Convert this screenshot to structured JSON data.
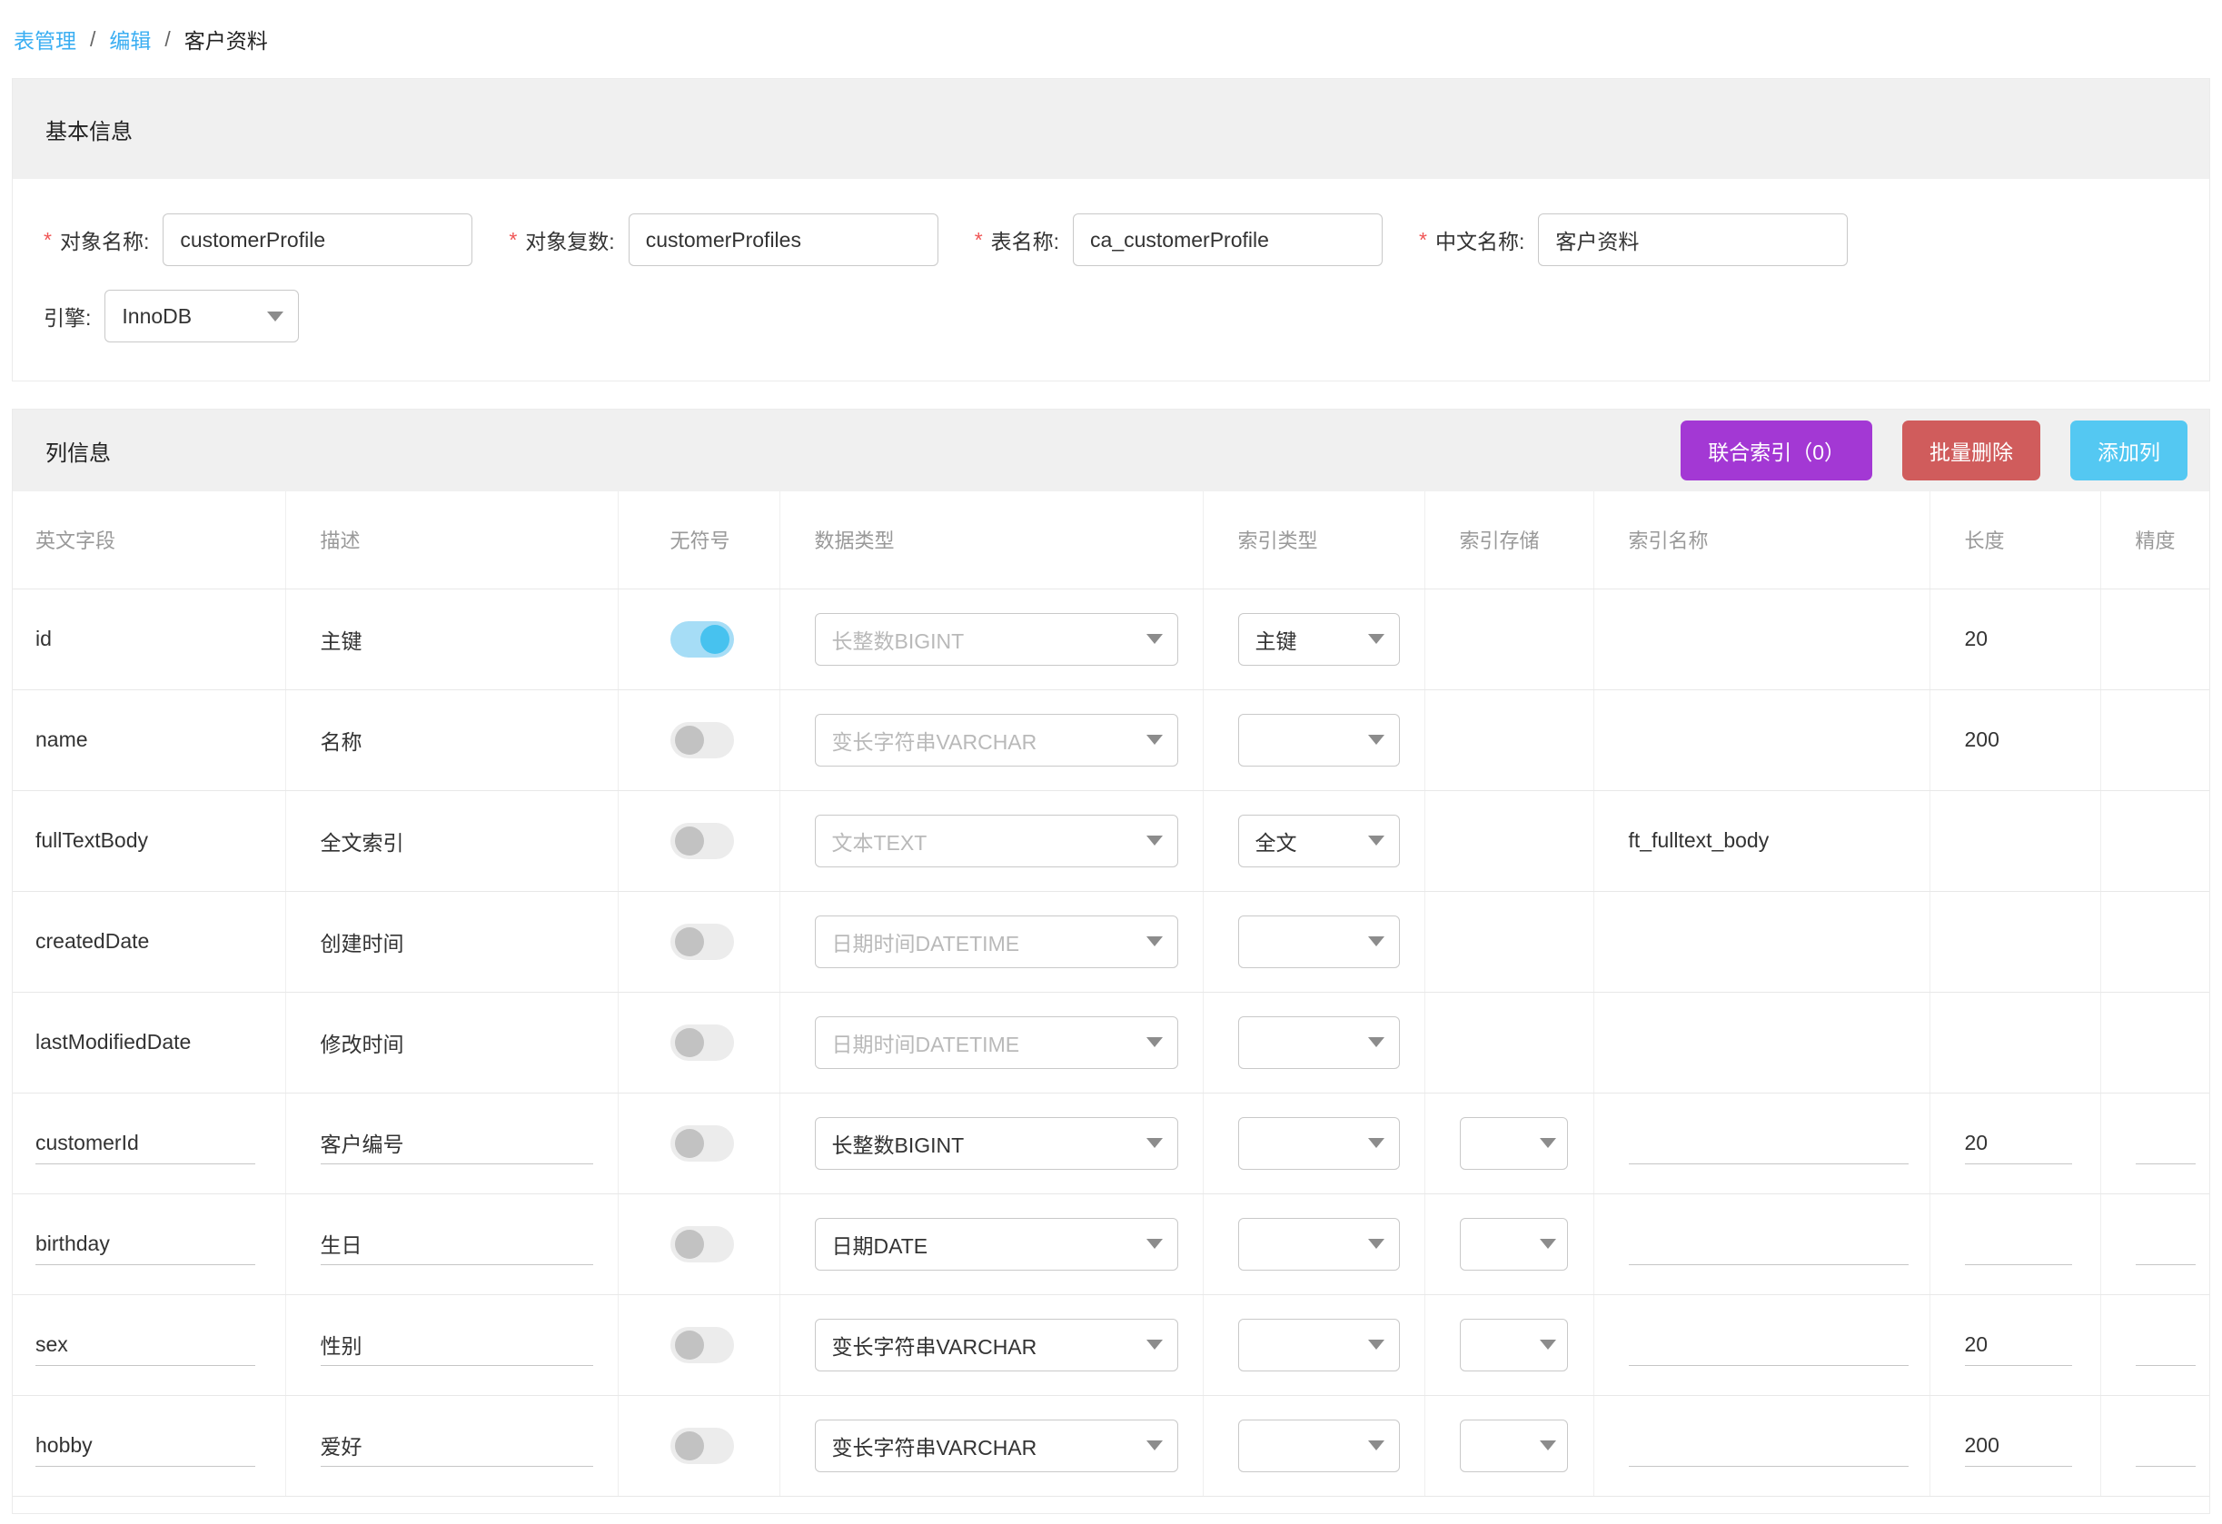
{
  "breadcrumb": {
    "separator": "/",
    "items": [
      {
        "label": "表管理"
      },
      {
        "label": "编辑"
      },
      {
        "label": "客户资料"
      }
    ]
  },
  "basic_info": {
    "title": "基本信息",
    "required_marker": "*",
    "fields": [
      {
        "label": "对象名称:",
        "required": true,
        "value": "customerProfile"
      },
      {
        "label": "对象复数:",
        "required": true,
        "value": "customerProfiles"
      },
      {
        "label": "表名称:",
        "required": true,
        "value": "ca_customerProfile"
      },
      {
        "label": "中文名称:",
        "required": true,
        "value": "客户资料"
      }
    ],
    "engine": {
      "label": "引擎:",
      "value": "InnoDB"
    }
  },
  "columns_section": {
    "title": "列信息",
    "buttons": [
      {
        "label": "联合索引（0）",
        "color": "#a338d4"
      },
      {
        "label": "批量删除",
        "color": "#d05c5c"
      },
      {
        "label": "添加列",
        "color": "#54c8f2"
      }
    ],
    "table": {
      "headers": [
        "英文字段",
        "描述",
        "无符号",
        "数据类型",
        "索引类型",
        "索引存储",
        "索引名称",
        "长度",
        "精度"
      ],
      "rows": [
        {
          "field": "id",
          "desc": "主键",
          "editable": false,
          "unsigned": true,
          "data_type": "长整数BIGINT",
          "data_type_disabled": true,
          "index_type": "主键",
          "index_storage": false,
          "index_name": "",
          "length": "20",
          "precision": ""
        },
        {
          "field": "name",
          "desc": "名称",
          "editable": false,
          "unsigned": false,
          "data_type": "变长字符串VARCHAR",
          "data_type_disabled": true,
          "index_type": "",
          "index_storage": false,
          "index_name": "",
          "length": "200",
          "precision": ""
        },
        {
          "field": "fullTextBody",
          "desc": "全文索引",
          "editable": false,
          "unsigned": false,
          "data_type": "文本TEXT",
          "data_type_disabled": true,
          "index_type": "全文",
          "index_storage": false,
          "index_name": "ft_fulltext_body",
          "length": "",
          "precision": ""
        },
        {
          "field": "createdDate",
          "desc": "创建时间",
          "editable": false,
          "unsigned": false,
          "data_type": "日期时间DATETIME",
          "data_type_disabled": true,
          "index_type": "",
          "index_storage": false,
          "index_name": "",
          "length": "",
          "precision": ""
        },
        {
          "field": "lastModifiedDate",
          "desc": "修改时间",
          "editable": false,
          "unsigned": false,
          "data_type": "日期时间DATETIME",
          "data_type_disabled": true,
          "index_type": "",
          "index_storage": false,
          "index_name": "",
          "length": "",
          "precision": ""
        },
        {
          "field": "customerId",
          "desc": "客户编号",
          "editable": true,
          "unsigned": false,
          "data_type": "长整数BIGINT",
          "data_type_disabled": false,
          "index_type": "",
          "index_storage": true,
          "index_name": "",
          "length": "20",
          "precision": ""
        },
        {
          "field": "birthday",
          "desc": "生日",
          "editable": true,
          "unsigned": false,
          "data_type": "日期DATE",
          "data_type_disabled": false,
          "index_type": "",
          "index_storage": true,
          "index_name": "",
          "length": "",
          "precision": ""
        },
        {
          "field": "sex",
          "desc": "性别",
          "editable": true,
          "unsigned": false,
          "data_type": "变长字符串VARCHAR",
          "data_type_disabled": false,
          "index_type": "",
          "index_storage": true,
          "index_name": "",
          "length": "20",
          "precision": ""
        },
        {
          "field": "hobby",
          "desc": "爱好",
          "editable": true,
          "unsigned": false,
          "data_type": "变长字符串VARCHAR",
          "data_type_disabled": false,
          "index_type": "",
          "index_storage": true,
          "index_name": "",
          "length": "200",
          "precision": ""
        }
      ]
    }
  },
  "icons": {
    "chevron_down_icon": "css-triangle-down",
    "toggle_on_color": "#47c2ef",
    "link_color": "#3aaef2",
    "required_color": "#f05555"
  }
}
